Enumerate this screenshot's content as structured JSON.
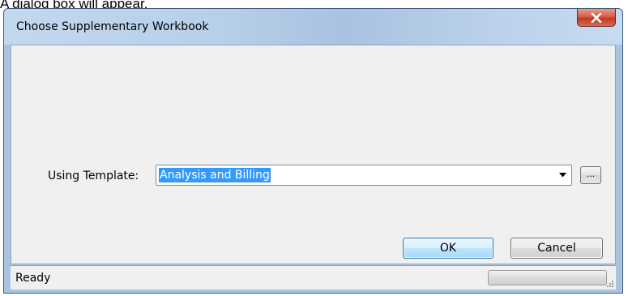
{
  "caption": "A dialog box will appear.",
  "window": {
    "title": "Choose Supplementary Workbook",
    "close_icon": "close-x-icon"
  },
  "form": {
    "template_label": "Using Template:",
    "template_value": "Analysis and Billing",
    "browse_label": "...",
    "dropdown_icon": "dropdown-arrow-icon"
  },
  "buttons": {
    "ok_label": "OK",
    "cancel_label": "Cancel"
  },
  "status": {
    "text": "Ready",
    "progress": 0
  },
  "colors": {
    "selection": "#3399ff",
    "close_button": "#c23a22",
    "title_bar": "#b8cfe9"
  }
}
